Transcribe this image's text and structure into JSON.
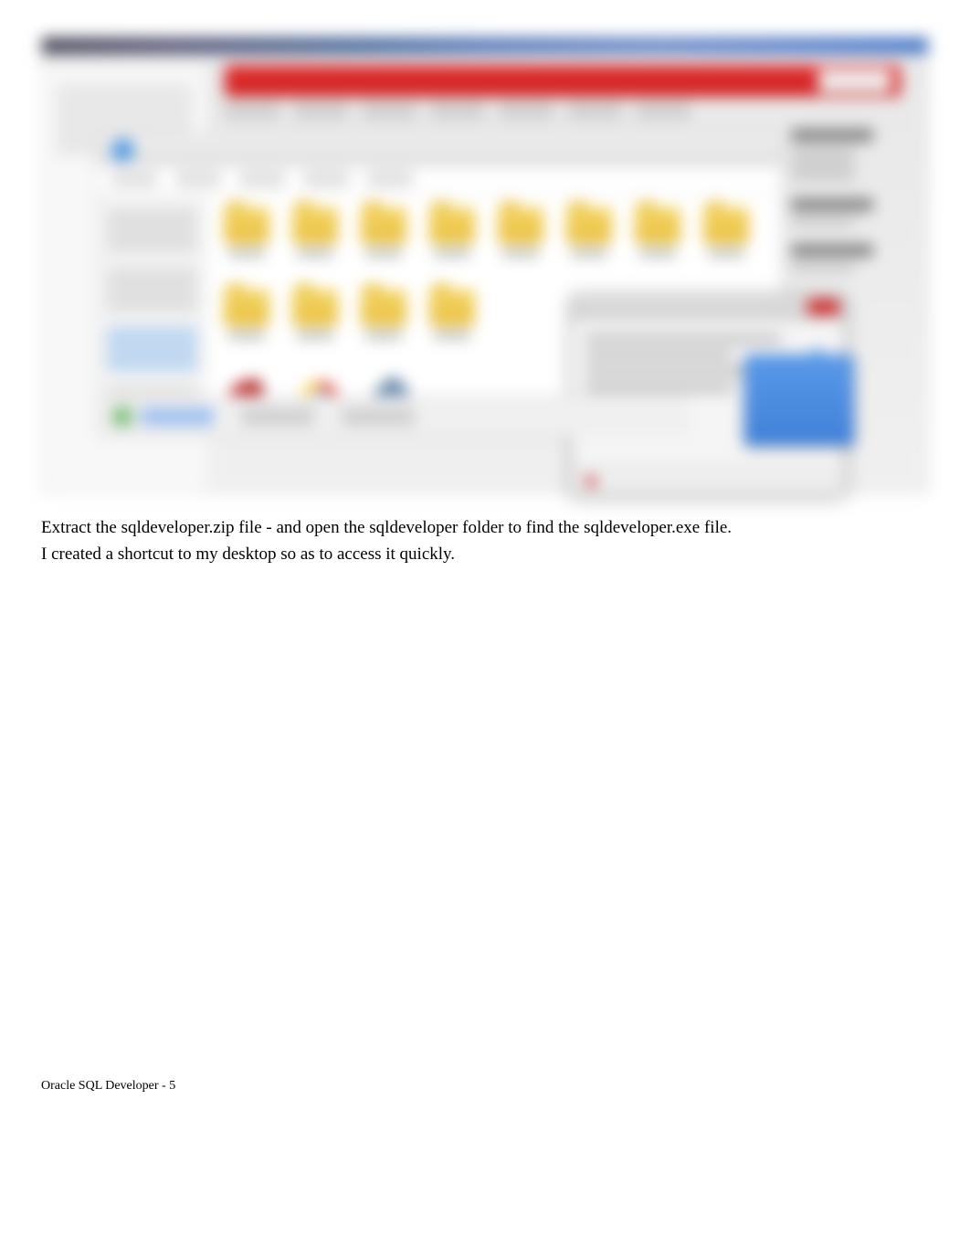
{
  "instructions": {
    "line1": "Extract the sqldeveloper.zip file - and open the sqldeveloper folder to find the sqldeveloper.exe file.",
    "line2": "I created a shortcut to my desktop so as to access it quickly."
  },
  "footer": {
    "text": "Oracle SQL Developer - 5"
  },
  "screenshot": {
    "description": "Blurred browser window showing file explorer with folder icons, application icons including Chrome, a popup dialog, and a download bar at the bottom"
  }
}
